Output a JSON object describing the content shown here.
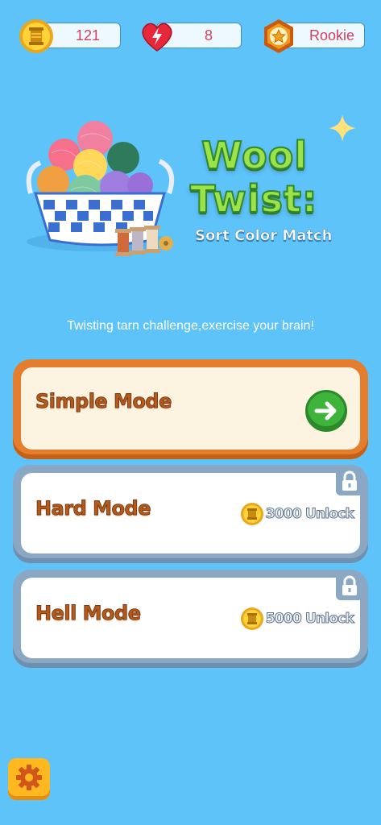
{
  "stats": {
    "coins": "121",
    "lives": "8",
    "rank": "Rookie"
  },
  "logo": {
    "line1": "Wool",
    "line2": "Twist:",
    "subtitle": "Sort Color Match"
  },
  "tagline": "Twisting tarn challenge,exercise your brain!",
  "modes": [
    {
      "title": "Simple Mode",
      "locked": false,
      "action_icon": "arrow-right-icon"
    },
    {
      "title": "Hard Mode",
      "locked": true,
      "unlock_cost": "3000 Unlock"
    },
    {
      "title": "Hell Mode",
      "locked": true,
      "unlock_cost": "5000 Unlock"
    }
  ],
  "icons": {
    "coins": "coin-spool-icon",
    "lives": "heart-lightning-icon",
    "rank": "star-badge-icon",
    "lock": "lock-icon",
    "settings": "gear-icon"
  },
  "colors": {
    "background": "#5ec3f9",
    "simple_frame": "#e47e2e",
    "locked_frame": "#8aa8c3",
    "go_button": "#3fb43a",
    "settings_button": "#ffb81f"
  }
}
